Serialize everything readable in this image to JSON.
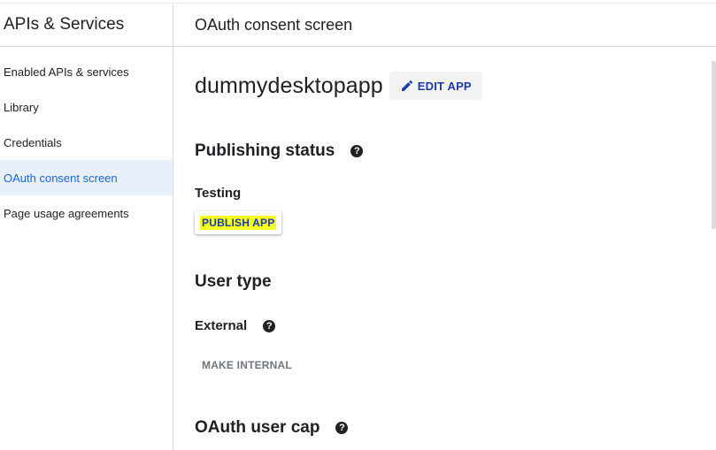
{
  "sidebar": {
    "title": "APIs & Services",
    "items": [
      {
        "label": "Enabled APIs & services"
      },
      {
        "label": "Library"
      },
      {
        "label": "Credentials"
      },
      {
        "label": "OAuth consent screen"
      },
      {
        "label": "Page usage agreements"
      }
    ]
  },
  "main": {
    "title": "OAuth consent screen",
    "app_name": "dummydesktopapp",
    "edit_label": "EDIT APP",
    "publishing": {
      "title": "Publishing status",
      "status": "Testing",
      "publish_label": "PUBLISH APP"
    },
    "user_type": {
      "title": "User type",
      "value": "External",
      "make_internal_label": "MAKE INTERNAL"
    },
    "user_cap": {
      "title": "OAuth user cap"
    }
  },
  "colors": {
    "active_bg": "#e8f0fe",
    "active_text": "#1967d2",
    "highlight": "#f4ff1f",
    "button_text": "#1c3aa9"
  },
  "icons": [
    "pencil-icon",
    "help-icon"
  ]
}
